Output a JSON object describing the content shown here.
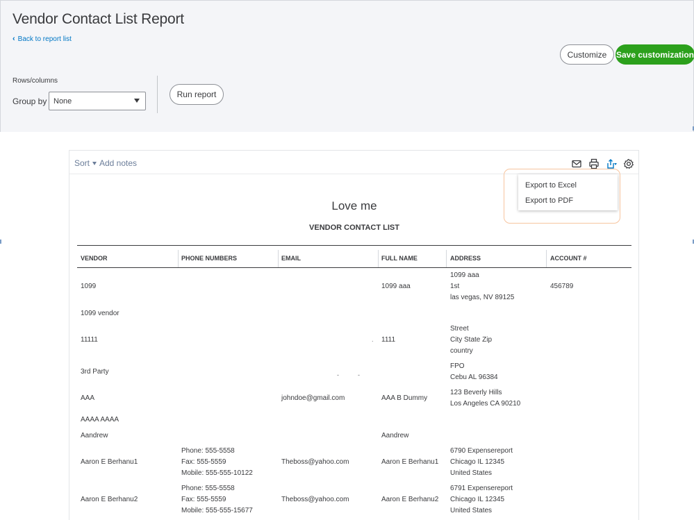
{
  "header": {
    "title": "Vendor Contact List Report",
    "back_label": "Back to report list",
    "customize_label": "Customize",
    "save_label": "Save customization"
  },
  "controls": {
    "rows_columns_label": "Rows/columns",
    "group_by_label": "Group by",
    "group_by_value": "None",
    "run_report_label": "Run report"
  },
  "toolbar": {
    "sort_label": "Sort",
    "add_notes_label": "Add notes",
    "icons": [
      "email-icon",
      "print-icon",
      "export-icon",
      "settings-icon"
    ]
  },
  "export_menu": {
    "items": [
      "Export to Excel",
      "Export to PDF"
    ]
  },
  "report": {
    "company_name": "Love me",
    "title": "VENDOR CONTACT LIST",
    "columns": [
      "VENDOR",
      "PHONE NUMBERS",
      "EMAIL",
      "FULL NAME",
      "ADDRESS",
      "ACCOUNT #"
    ],
    "rows": [
      {
        "vendor": "1099",
        "phone": "",
        "email": "",
        "full_name": "1099 aaa",
        "address": "1099 aaa\n1st\nlas vegas, NV 89125",
        "account": "456789"
      },
      {
        "vendor": "1099 vendor",
        "phone": "",
        "email": "",
        "full_name": "",
        "address": "",
        "account": ""
      },
      {
        "vendor": "11111",
        "phone": "",
        "email": "",
        "full_name": "1111",
        "address": "Street\nCity State Zip\ncountry",
        "account": ""
      },
      {
        "vendor": "3rd Party",
        "phone": "",
        "email": "",
        "full_name": "",
        "address": "FPO\nCebu AL 96384",
        "account": ""
      },
      {
        "vendor": "AAA",
        "phone": "",
        "email": "johndoe@gmail.com",
        "full_name": "AAA B Dummy",
        "address": "123 Beverly Hills\nLos Angeles CA 90210",
        "account": ""
      },
      {
        "vendor": "AAAA AAAA",
        "phone": "",
        "email": "",
        "full_name": "",
        "address": "",
        "account": ""
      },
      {
        "vendor": "Aandrew",
        "phone": "",
        "email": "",
        "full_name": "Aandrew",
        "address": "",
        "account": ""
      },
      {
        "vendor": "Aaron E Berhanu1",
        "phone": "Phone: 555-5558\nFax: 555-5559\nMobile: 555-555-10122",
        "email": "Theboss@yahoo.com",
        "full_name": "Aaron E Berhanu1",
        "address": "6790 Expensereport\nChicago IL 12345\nUnited States",
        "account": ""
      },
      {
        "vendor": "Aaron E Berhanu2",
        "phone": "Phone: 555-5558\nFax: 555-5559\nMobile: 555-555-15677",
        "email": "Theboss@yahoo.com",
        "full_name": "Aaron E Berhanu2",
        "address": "6791 Expensereport\nChicago IL 12345\nUnited States",
        "account": ""
      }
    ]
  },
  "colors": {
    "primary_green": "#2ca01c",
    "link_blue": "#0077c5",
    "text": "#393a3d",
    "panel_bg": "#f4f5f8",
    "highlight_orange": "#f7c59f"
  }
}
